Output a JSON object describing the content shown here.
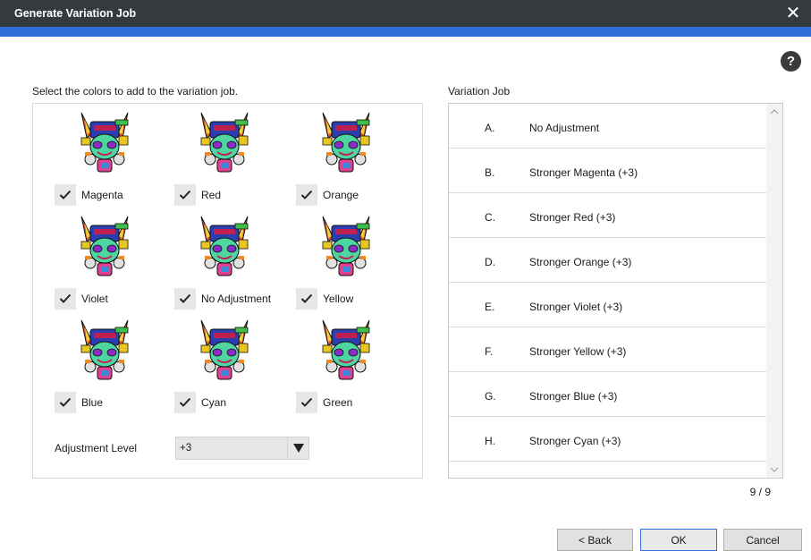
{
  "window": {
    "title": "Generate Variation Job",
    "close_glyph": "✕"
  },
  "help_glyph": "?",
  "colors_section": {
    "label": "Select the colors to add to the variation job.",
    "options": [
      {
        "label": "Magenta",
        "checked": true
      },
      {
        "label": "Red",
        "checked": true
      },
      {
        "label": "Orange",
        "checked": true
      },
      {
        "label": "Violet",
        "checked": true
      },
      {
        "label": "No Adjustment",
        "checked": true
      },
      {
        "label": "Yellow",
        "checked": true
      },
      {
        "label": "Blue",
        "checked": true
      },
      {
        "label": "Cyan",
        "checked": true
      },
      {
        "label": "Green",
        "checked": true
      }
    ],
    "adjustment_label": "Adjustment Level",
    "adjustment_value": "+3"
  },
  "job_section": {
    "label": "Variation Job",
    "rows": [
      {
        "letter": "A.",
        "name": "No Adjustment"
      },
      {
        "letter": "B.",
        "name": "Stronger Magenta (+3)"
      },
      {
        "letter": "C.",
        "name": "Stronger Red (+3)"
      },
      {
        "letter": "D.",
        "name": "Stronger Orange (+3)"
      },
      {
        "letter": "E.",
        "name": "Stronger Violet (+3)"
      },
      {
        "letter": "F.",
        "name": "Stronger Yellow (+3)"
      },
      {
        "letter": "G.",
        "name": "Stronger Blue (+3)"
      },
      {
        "letter": "H.",
        "name": "Stronger Cyan (+3)"
      }
    ],
    "count": "9 / 9"
  },
  "buttons": {
    "back": "< Back",
    "ok": "OK",
    "cancel": "Cancel"
  },
  "colors": {
    "titlebar": "#353a3e",
    "accent": "#2f6fd6",
    "checkbox": "#e7e7e7"
  }
}
